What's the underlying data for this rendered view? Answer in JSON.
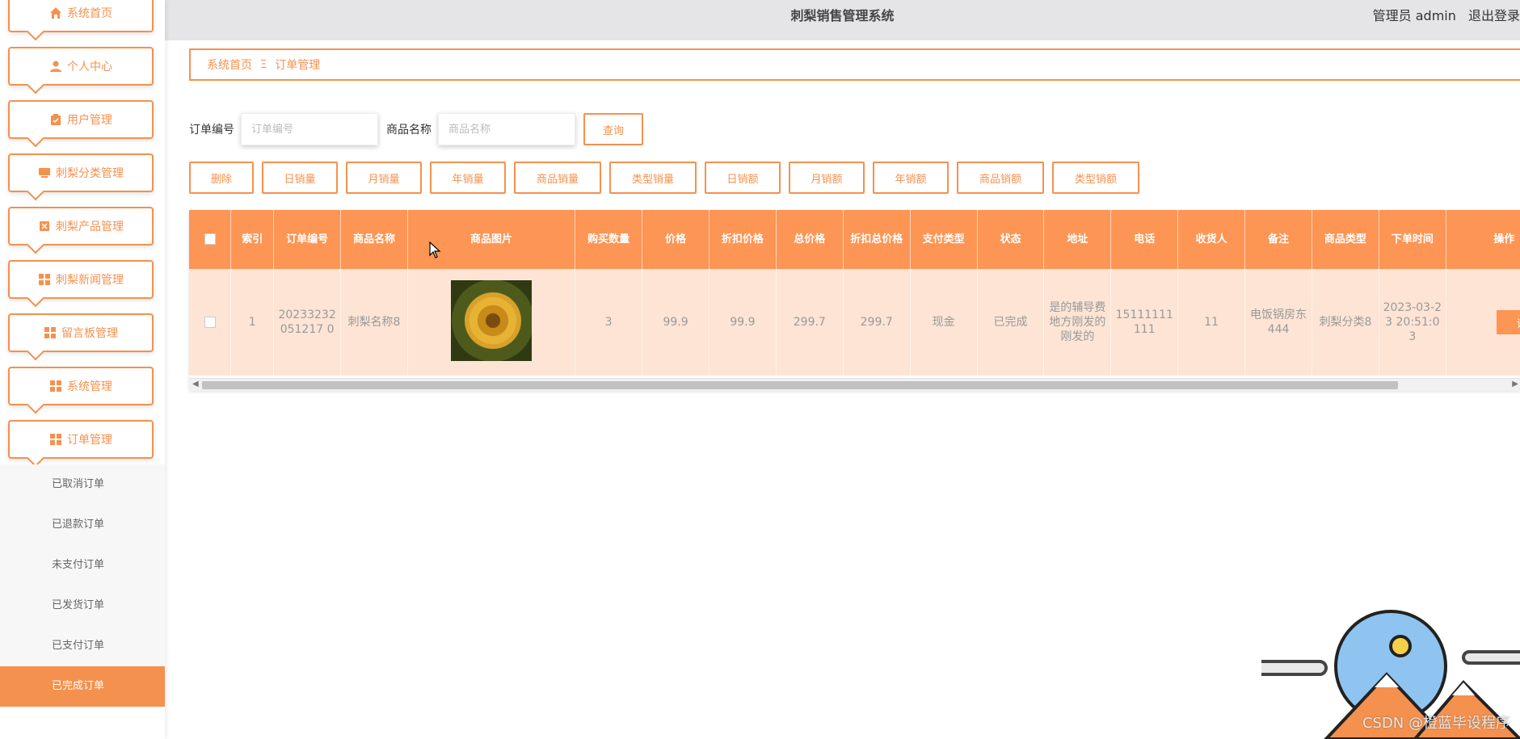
{
  "app": {
    "title": "刺梨销售管理系统",
    "admin_label": "管理员 admin",
    "logout_label": "退出登录"
  },
  "sidebar": {
    "items": [
      {
        "label": "系统首页",
        "icon": "home-icon"
      },
      {
        "label": "个人中心",
        "icon": "user-icon"
      },
      {
        "label": "用户管理",
        "icon": "clipboard-icon"
      },
      {
        "label": "刺梨分类管理",
        "icon": "monitor-icon"
      },
      {
        "label": "刺梨产品管理",
        "icon": "package-icon"
      },
      {
        "label": "刺梨新闻管理",
        "icon": "grid-icon"
      },
      {
        "label": "留言板管理",
        "icon": "grid-icon"
      },
      {
        "label": "系统管理",
        "icon": "grid-icon"
      },
      {
        "label": "订单管理",
        "icon": "grid-icon"
      }
    ],
    "sub_items": [
      {
        "label": "已取消订单"
      },
      {
        "label": "已退款订单"
      },
      {
        "label": "未支付订单"
      },
      {
        "label": "已发货订单"
      },
      {
        "label": "已支付订单"
      },
      {
        "label": "已完成订单",
        "active": true
      }
    ]
  },
  "breadcrumb": {
    "home": "系统首页",
    "separator": "Ξ",
    "current": "订单管理"
  },
  "search": {
    "order_label": "订单编号",
    "order_placeholder": "订单编号",
    "product_label": "商品名称",
    "product_placeholder": "商品名称",
    "query_label": "查询"
  },
  "actions": [
    {
      "label": "删除"
    },
    {
      "label": "日销量"
    },
    {
      "label": "月销量"
    },
    {
      "label": "年销量"
    },
    {
      "label": "商品销量"
    },
    {
      "label": "类型销量"
    },
    {
      "label": "日销额"
    },
    {
      "label": "月销额"
    },
    {
      "label": "年销额"
    },
    {
      "label": "商品销额"
    },
    {
      "label": "类型销额"
    }
  ],
  "table": {
    "headers": [
      "索引",
      "订单编号",
      "商品名称",
      "商品图片",
      "购买数量",
      "价格",
      "折扣价格",
      "总价格",
      "折扣总价格",
      "支付类型",
      "状态",
      "地址",
      "电话",
      "收货人",
      "备注",
      "商品类型",
      "下单时间",
      "操作"
    ],
    "rows": [
      {
        "index": "1",
        "order_no": "20233232051217 0",
        "product_name": "刺梨名称8",
        "quantity": "3",
        "price": "99.9",
        "discount_price": "99.9",
        "total": "299.7",
        "discount_total": "299.7",
        "pay_type": "现金",
        "status": "已完成",
        "address": "是的辅导费地方刚发的刚发的",
        "phone": "15111111111",
        "receiver": "11",
        "remark": "电饭锅房东444",
        "product_type": "刺梨分类8",
        "order_time": "2023-03-23 20:51:03",
        "detail_label": "详情"
      }
    ]
  },
  "watermark": "CSDN @橙蓝毕设程序",
  "colors": {
    "accent": "#f5914e",
    "table_header": "#fd9554",
    "row_bg": "#fde4d4",
    "topbar_bg": "#e5e5e7"
  }
}
